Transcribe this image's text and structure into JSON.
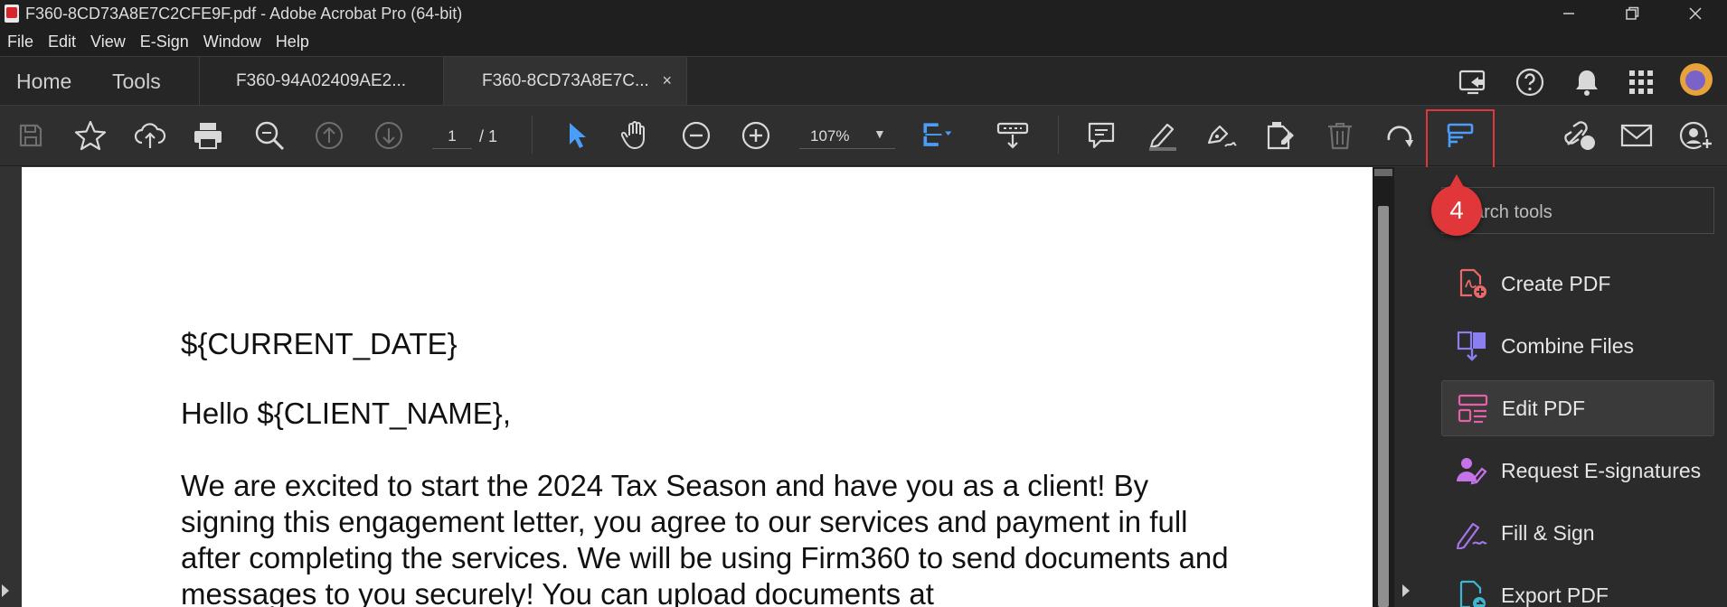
{
  "window": {
    "title": "F360-8CD73A8E7C2CFE9F.pdf - Adobe Acrobat Pro (64-bit)",
    "controls": [
      "minimize",
      "restore",
      "close"
    ]
  },
  "menu": [
    "File",
    "Edit",
    "View",
    "E-Sign",
    "Window",
    "Help"
  ],
  "nav": {
    "home": "Home",
    "tools": "Tools",
    "tabs": [
      {
        "label": "F360-94A02409AE2...",
        "active": false
      },
      {
        "label": "F360-8CD73A8E7C...",
        "active": true,
        "close": "×"
      }
    ]
  },
  "toolbar": {
    "page_current": "1",
    "page_total": "/  1",
    "zoom": "107%"
  },
  "document": {
    "date_line": "${CURRENT_DATE}",
    "greeting": "Hello ${CLIENT_NAME},",
    "paragraph": "We are excited to start the 2024 Tax Season and have you as a client! By signing this engagement letter, you agree to our services and payment in full after completing the services. We will be using Firm360 to send documents and messages to you securely! You can upload documents at"
  },
  "right_pane": {
    "search_placeholder": "arch tools",
    "badge": "4",
    "tools": [
      {
        "label": "Create PDF",
        "icon": "create-pdf-icon"
      },
      {
        "label": "Combine Files",
        "icon": "combine-files-icon"
      },
      {
        "label": "Edit PDF",
        "icon": "edit-pdf-icon",
        "active": true
      },
      {
        "label": "Request E-signatures",
        "icon": "request-esign-icon"
      },
      {
        "label": "Fill & Sign",
        "icon": "fill-sign-icon"
      },
      {
        "label": "Export PDF",
        "icon": "export-pdf-icon"
      }
    ]
  },
  "colors": {
    "accent_red": "#e2373a",
    "accent_blue": "#4a9df8",
    "background": "#323232"
  }
}
